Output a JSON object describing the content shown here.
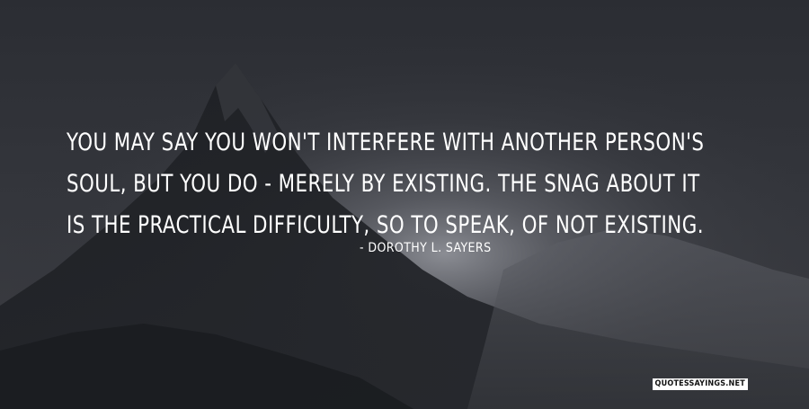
{
  "quote": {
    "lines": [
      "You may say you won't interfere with another person's",
      "soul, but you do - merely by existing. The snag about it",
      "is the practical difficulty, so to speak, of not existing."
    ]
  },
  "author": "- Dorothy L. Sayers",
  "watermark": "QUOTESSAYINGS.NET"
}
